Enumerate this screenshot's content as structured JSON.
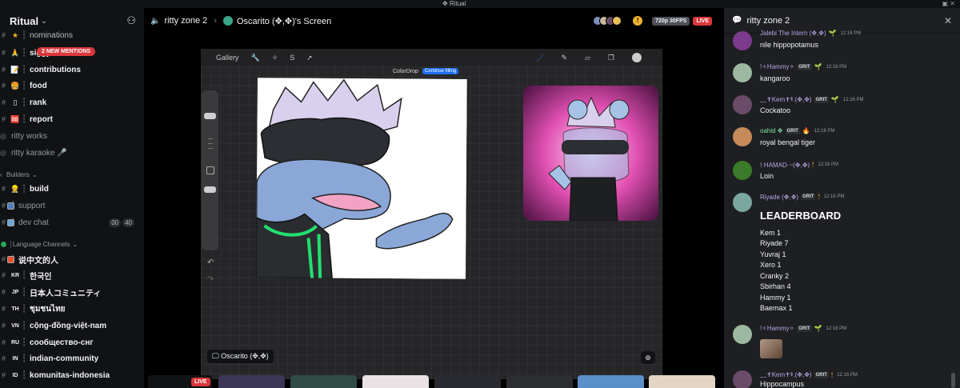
{
  "titlebar": {
    "title": "✥ Ritual"
  },
  "server": {
    "name": "Ritual",
    "mentions_badge": "2 NEW MENTIONS"
  },
  "channels": [
    {
      "name": "nominations",
      "emoji": "★",
      "muted": false
    },
    {
      "name": "siggys-shrine",
      "emoji": "🙏",
      "muted": false
    },
    {
      "name": "contributions",
      "emoji": "📝",
      "muted": false
    },
    {
      "name": "food",
      "emoji": "🍔",
      "muted": false
    },
    {
      "name": "rank",
      "emoji": "▯",
      "muted": false
    },
    {
      "name": "report",
      "emoji": "🆘",
      "muted": false
    },
    {
      "name": "ritty works",
      "emoji": "",
      "muted": true
    },
    {
      "name": "ritty karaoke 🎤",
      "emoji": "",
      "muted": true
    }
  ],
  "categories": {
    "builders": "Builders",
    "language": "Language Channels"
  },
  "builder_channels": [
    {
      "name": "build",
      "emoji": "👷",
      "muted": false
    },
    {
      "name": "support",
      "emoji": "",
      "muted": true
    },
    {
      "name": "dev chat",
      "emoji": "",
      "muted": true,
      "counts": [
        "00",
        "40"
      ]
    }
  ],
  "language_channels": [
    {
      "code": "",
      "name": "说中文的人"
    },
    {
      "code": "KR",
      "name": "한국인"
    },
    {
      "code": "JP",
      "name": "日本人コミュニティ"
    },
    {
      "code": "TH",
      "name": "ชุมชนไทย"
    },
    {
      "code": "VN",
      "name": "cộng-đồng-việt-nam"
    },
    {
      "code": "RU",
      "name": "сообщество-снг"
    },
    {
      "code": "IN",
      "name": "indian-community"
    },
    {
      "code": "ID",
      "name": "komunitas-indonesia"
    }
  ],
  "stream": {
    "channel": "ritty zone 2",
    "screen_title": "Oscarito (✥,✥)'s Screen",
    "quality": "720p 30FPS",
    "live": "LIVE",
    "owner_label": "Oscarito (✥,✥)"
  },
  "procreate": {
    "gallery": "Gallery",
    "colordrop": "ColorDrop",
    "continue": "Continue filling"
  },
  "chat": {
    "title": "ritty zone 2",
    "messages": [
      {
        "name": "Jalebi The Intern (✥,✥)",
        "color": "#b7a6e6",
        "badge": "",
        "time": "12:16 PM",
        "text": "nile hippopotamus",
        "avatar": "#7c3a8c"
      },
      {
        "name": "!✧Hammy✧",
        "color": "#b7a6e6",
        "badge": "GRIT",
        "time": "12:16 PM",
        "text": "kangaroo",
        "avatar": "#9db8a0"
      },
      {
        "name": "﹏✝Kem✝ᙚ.(✥,✥)",
        "color": "#b7a6e6",
        "badge": "GRIT",
        "time": "12:16 PM",
        "text": "Cockatoo",
        "avatar": "#6b4b6a"
      },
      {
        "name": "oahid ✥",
        "color": "#7ee0a3",
        "badge": "GRIT",
        "time": "12:16 PM",
        "text": "royal bengal tiger",
        "avatar": "#c58a5a"
      },
      {
        "name": "!·HAMAD·~(✥,✥)",
        "color": "#b7a6e6",
        "badge": "",
        "time": "12:16 PM",
        "text": "Loin",
        "avatar": "#3b7a2a"
      },
      {
        "name": "Riyade (✥,✥)",
        "color": "#b7a6e6",
        "badge": "GRIT",
        "time": "12:16 PM",
        "text": "",
        "avatar": "#7aa7a0"
      },
      {
        "name": "!✧Hammy✧",
        "color": "#b7a6e6",
        "badge": "GRIT",
        "time": "12:16 PM",
        "text": "",
        "avatar": "#9db8a0"
      },
      {
        "name": "﹏✝Kem✝ᙚ.(✥,✥)",
        "color": "#b7a6e6",
        "badge": "GRIT",
        "time": "12:16 PM",
        "text": "Hippocampus",
        "avatar": "#6b4b6a"
      }
    ],
    "leaderboard_title": "LEADERBOARD",
    "leaderboard": [
      "Kem 1",
      "Riyade 7",
      "Yuvraj 1",
      "Xero 1",
      "Cranky 2",
      "Sbirhan 4",
      "Hammy 1",
      "Baemax 1"
    ]
  }
}
